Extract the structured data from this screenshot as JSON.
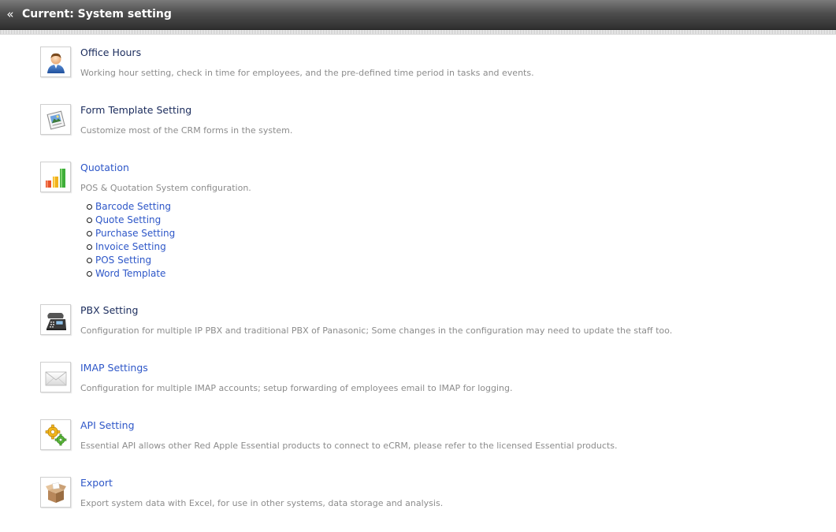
{
  "header": {
    "title": "Current: System setting",
    "back_icon": "double-chevron-left-icon"
  },
  "sections": [
    {
      "key": "office-hours",
      "title": "Office Hours",
      "description": "Working hour setting, check in time for employees, and the pre-defined time period in tasks and events.",
      "icon": "person-icon"
    },
    {
      "key": "form-template",
      "title": "Form Template Setting",
      "description": "Customize most of the CRM forms in the system.",
      "icon": "form-template-icon"
    },
    {
      "key": "quotation",
      "title": "Quotation",
      "description": "POS & Quotation System configuration.",
      "icon": "bar-chart-icon",
      "subitems": [
        "Barcode Setting",
        "Quote Setting",
        "Purchase Setting",
        "Invoice Setting",
        "POS Setting",
        "Word Template"
      ]
    },
    {
      "key": "pbx",
      "title": "PBX Setting",
      "description": "Configuration for multiple IP PBX and traditional PBX of Panasonic; Some changes in the configuration may need to update the staff too.",
      "icon": "phone-icon"
    },
    {
      "key": "imap",
      "title": "IMAP Settings",
      "description": "Configuration for multiple IMAP accounts; setup forwarding of employees email to IMAP for logging.",
      "icon": "envelope-icon"
    },
    {
      "key": "api",
      "title": "API Setting",
      "description": "Essential API allows other Red Apple Essential products to connect to eCRM, please refer to the licensed Essential products.",
      "icon": "gears-icon"
    },
    {
      "key": "export",
      "title": "Export",
      "description": "Export system data with Excel, for use in other systems, data storage and analysis.",
      "icon": "box-icon"
    }
  ]
}
